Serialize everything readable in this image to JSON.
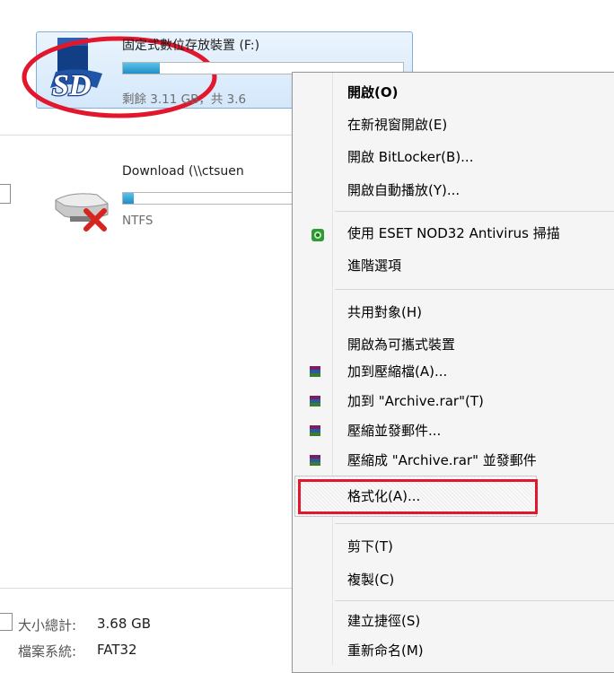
{
  "drives": [
    {
      "name": "固定式數位存放裝置 (F:)",
      "usage_text": "剩餘 3.11 GB，共 3.6",
      "used_fraction": 0.13
    },
    {
      "name": "Download (\\\\ctsuen",
      "filesystem": "NTFS",
      "used_fraction": 0.06
    }
  ],
  "details": {
    "total_size_label": "大小總計:",
    "total_size_value": "3.68 GB",
    "filesystem_label": "檔案系統:",
    "filesystem_value": "FAT32"
  },
  "context_menu": {
    "items": [
      {
        "label": "開啟(O)"
      },
      {
        "label": "在新視窗開啟(E)"
      },
      {
        "label": "開啟 BitLocker(B)..."
      },
      {
        "label": "開啟自動播放(Y)..."
      },
      {
        "label": "使用 ESET NOD32 Antivirus 掃描"
      },
      {
        "label": "進階選項"
      },
      {
        "label": "共用對象(H)"
      },
      {
        "label": "開啟為可攜式裝置"
      },
      {
        "label": "加到壓縮檔(A)..."
      },
      {
        "label": "加到 \"Archive.rar\"(T)"
      },
      {
        "label": "壓縮並發郵件..."
      },
      {
        "label": "壓縮成 \"Archive.rar\" 並發郵件"
      },
      {
        "label": "格式化(A)..."
      },
      {
        "label": "剪下(T)"
      },
      {
        "label": "複製(C)"
      },
      {
        "label": "建立捷徑(S)"
      },
      {
        "label": "重新命名(M)"
      }
    ]
  },
  "colors": {
    "annotation_red": "#e2162d",
    "menu_background": "#f5f5f5",
    "selection_blue": "#d4e8fb",
    "progress_blue": "#1f8fc7"
  },
  "icons": [
    "sd-card-icon",
    "network-drive-disconnected-icon",
    "eset-icon",
    "winrar-icon"
  ]
}
